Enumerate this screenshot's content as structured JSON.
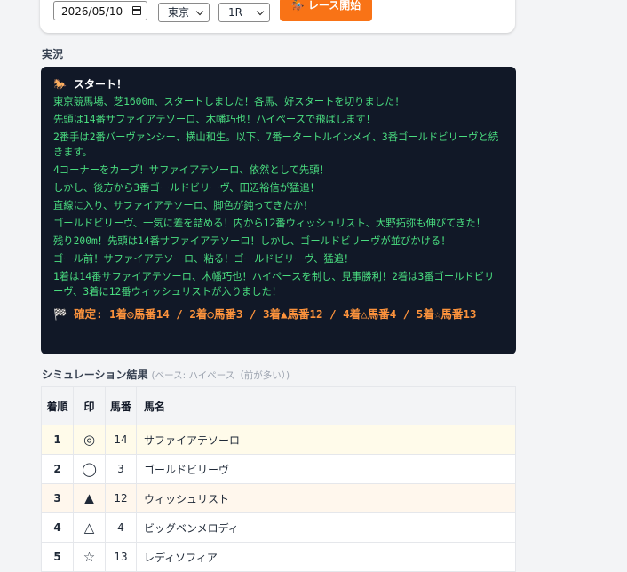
{
  "controls": {
    "date_value": "2026/05/10",
    "venue": "東京",
    "race": "1R",
    "start_label": "🏇 レース開始"
  },
  "commentary_heading": "実況",
  "commentary": {
    "title": "スタート！",
    "lines": [
      "東京競馬場、芝1600m、スタートしました！各馬、好スタートを切りました！",
      "先頭は14番サファイアテソーロ、木幡巧也！ハイペースで飛ばします！",
      "2番手は2番バーヴァンシー、横山和生。以下、7番ータートルインメイ、3番ゴールドビリーヴと続きます。",
      "4コーナーをカーブ！サファイアテソーロ、依然として先頭！",
      "しかし、後方から3番ゴールドビリーヴ、田辺裕信が猛追！",
      "直線に入り、サファイアテソーロ、脚色が鈍ってきたか！",
      "ゴールドビリーヴ、一気に差を詰める！内から12番ウィッシュリスト、大野拓弥も伸びてきた！",
      "残り200m！先頭は14番サファイアテソーロ！しかし、ゴールドビリーヴが並びかける！",
      "ゴール前！サファイアテソーロ、粘る！ゴールドビリーヴ、猛追！",
      "1着は14番サファイアテソーロ、木幡巧也！ハイペースを制し、見事勝利！2着は3番ゴールドビリーヴ、3着に12番ウィッシュリストが入りました！"
    ],
    "result": "🏁 確定: 1着◎馬番14 / 2着○馬番3 / 3着▲馬番12 / 4着△馬番4 / 5着☆馬番13"
  },
  "simulation": {
    "title": "シミュレーション結果",
    "subtitle": "(ベース: ハイペース（前が多い）)",
    "headers": {
      "rank": "着順",
      "mark": "印",
      "number": "馬番",
      "name": "馬名"
    },
    "rows": [
      {
        "rank": "1",
        "mark": "◎",
        "number": "14",
        "name": "サファイアテソーロ"
      },
      {
        "rank": "2",
        "mark": "◯",
        "number": "3",
        "name": "ゴールドビリーヴ"
      },
      {
        "rank": "3",
        "mark": "▲",
        "number": "12",
        "name": "ウィッシュリスト"
      },
      {
        "rank": "4",
        "mark": "△",
        "number": "4",
        "name": "ビッグベンメロディ"
      },
      {
        "rank": "5",
        "mark": "☆",
        "number": "13",
        "name": "レディソフィア"
      }
    ]
  },
  "colors": {
    "accent": "#f97316",
    "commentary_bg": "#111827",
    "commentary_text": "#4ade80",
    "result_text": "#fb923c"
  }
}
